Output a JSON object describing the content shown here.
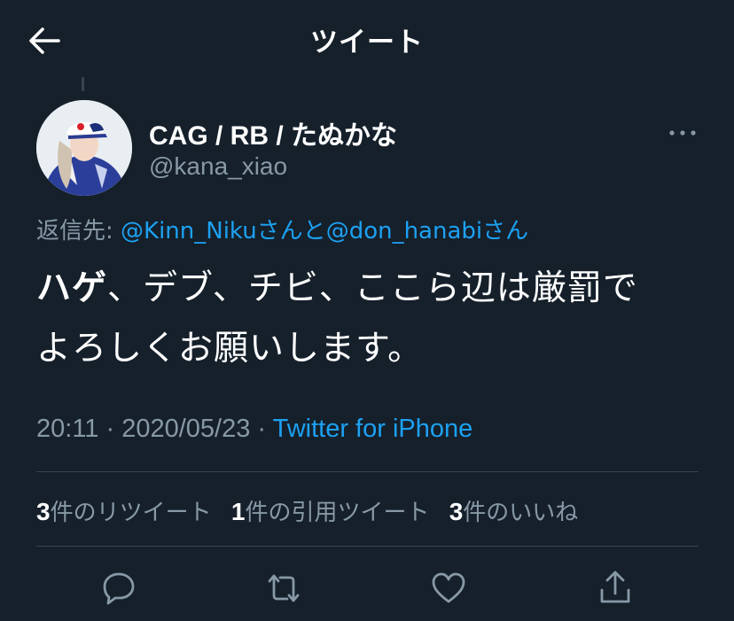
{
  "header": {
    "title": "ツイート"
  },
  "tweet": {
    "author": {
      "display_name_latin": "CAG / RB / ",
      "display_name_jp": "たぬかな",
      "handle": "@kana_xiao"
    },
    "reply_to": {
      "prefix": "返信先: ",
      "mention1": "@Kinn_Niku",
      "sep1": "さんと",
      "mention2": "@don_hanabi",
      "sep2": "さん"
    },
    "text": {
      "bold": "ハゲ",
      "line1_rest": "、デブ、チビ、ここら辺は厳罰で",
      "line2": "よろしくお願いします。"
    },
    "time": "20:11 · 2020/05/23 · ",
    "source": "Twitter for iPhone"
  },
  "stats": {
    "retweets_count": "3",
    "retweets_label": "件のリツイート",
    "quotes_count": "1",
    "quotes_label": "件の引用ツイート",
    "likes_count": "3",
    "likes_label": "件のいいね"
  },
  "icons": {
    "back": "arrow-left-icon",
    "more": "more-icon",
    "reply": "reply-icon",
    "retweet": "retweet-icon",
    "like": "heart-icon",
    "share": "share-icon"
  },
  "colors": {
    "background": "#15202b",
    "primary_text": "#ffffff",
    "secondary_text": "#8899a6",
    "accent": "#1da1f2",
    "divider": "#38444d"
  }
}
